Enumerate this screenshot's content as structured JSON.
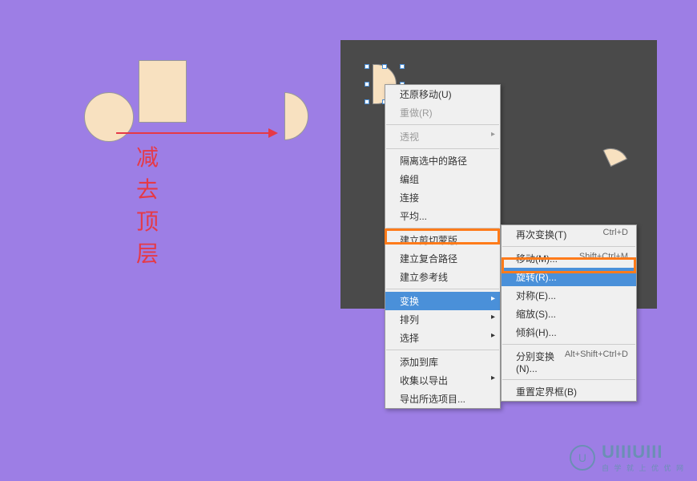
{
  "label_text": "减去顶层",
  "menu1": {
    "undo": "还原移动(U)",
    "redo": "重做(R)",
    "perspective": "透视",
    "isolate": "隔离选中的路径",
    "ungroup": "编组",
    "join": "连接",
    "average": "平均...",
    "clipmask": "建立剪切蒙版",
    "compound": "建立复合路径",
    "guides": "建立参考线",
    "transform": "变换",
    "arrange": "排列",
    "select": "选择",
    "addlib": "添加到库",
    "collect": "收集以导出",
    "exportsel": "导出所选项目..."
  },
  "menu2": {
    "again": "再次变换(T)",
    "again_k": "Ctrl+D",
    "move": "移动(M)...",
    "move_k": "Shift+Ctrl+M",
    "rotate": "旋转(R)...",
    "reflect": "对称(E)...",
    "scale": "缩放(S)...",
    "shear": "倾斜(H)...",
    "each": "分别变换(N)...",
    "each_k": "Alt+Shift+Ctrl+D",
    "reset": "重置定界框(B)"
  },
  "logo": {
    "text": "UIIIUIII",
    "sub": "自 学 就 上 优 优 网",
    "icon": "U"
  }
}
